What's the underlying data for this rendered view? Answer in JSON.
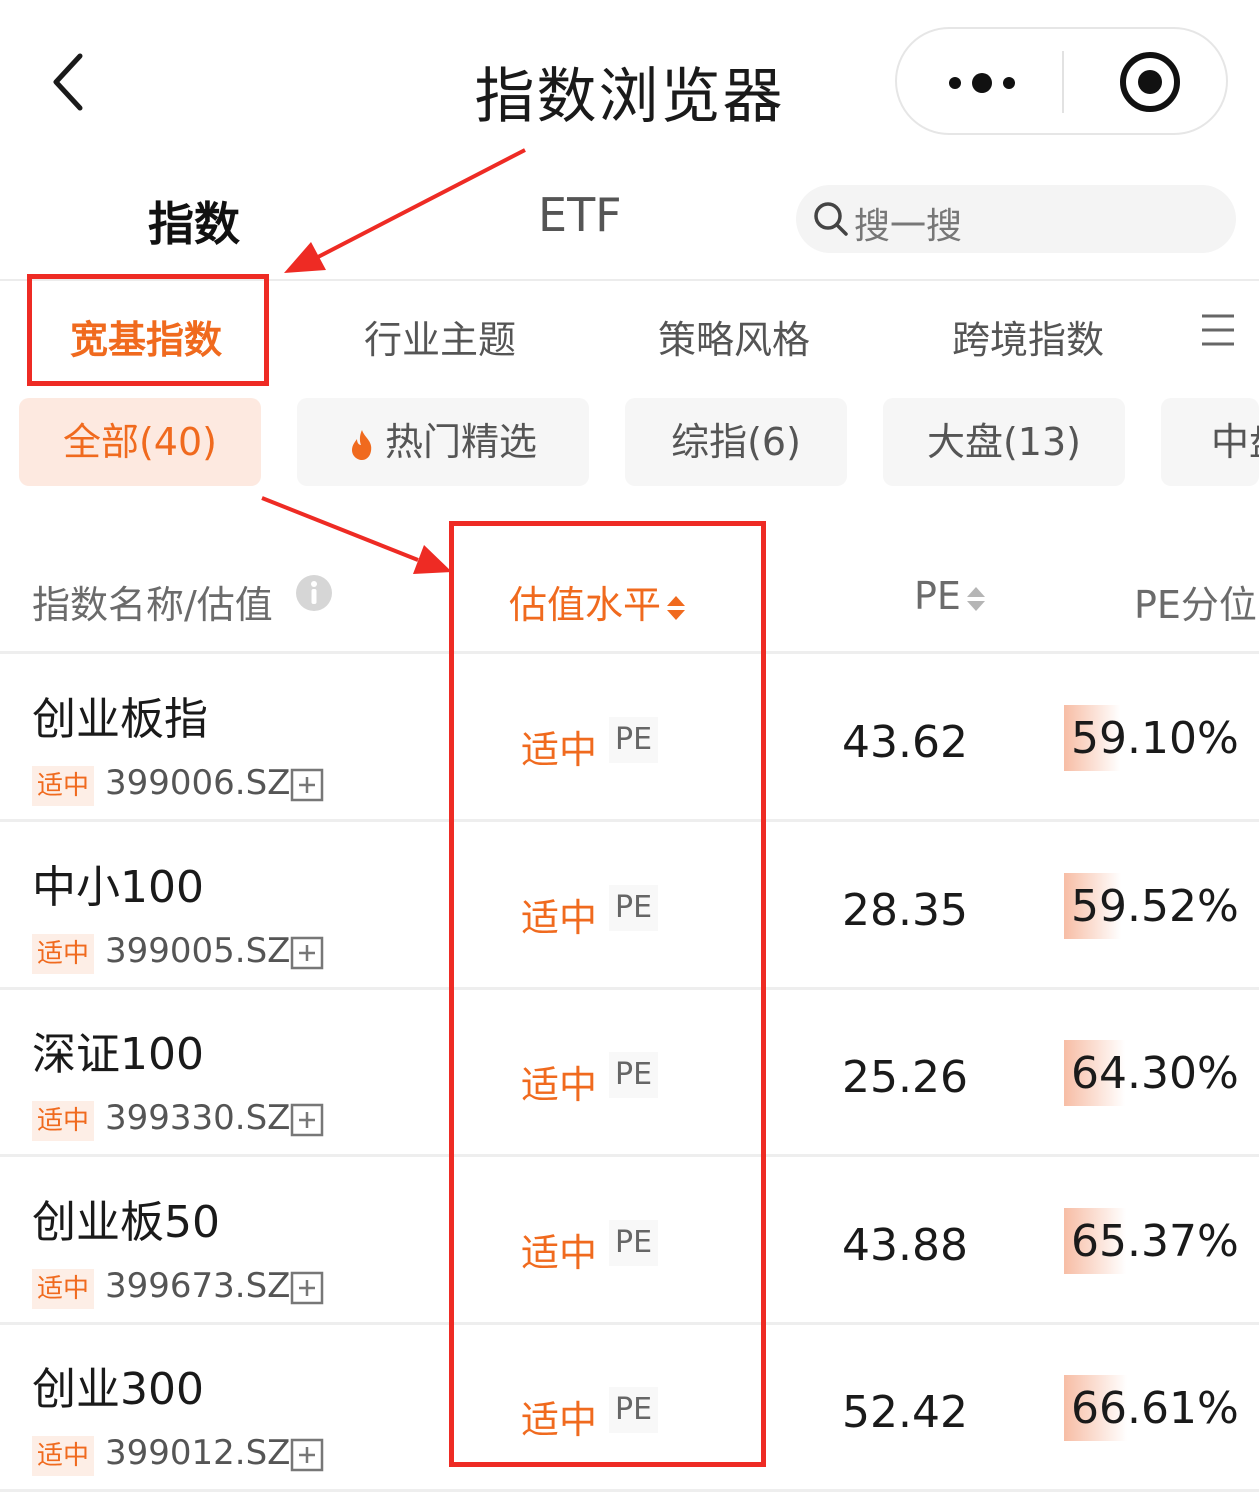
{
  "header": {
    "title": "指数浏览器",
    "icons": [
      "back-icon",
      "more-dots-icon",
      "target-icon"
    ]
  },
  "primary_tabs": [
    {
      "label": "指数",
      "active": true
    },
    {
      "label": "ETF",
      "active": false
    }
  ],
  "search": {
    "placeholder": "搜一搜",
    "icon": "search-icon"
  },
  "category_tabs": [
    {
      "label": "宽基指数",
      "active": true
    },
    {
      "label": "行业主题",
      "active": false
    },
    {
      "label": "策略风格",
      "active": false
    },
    {
      "label": "跨境指数",
      "active": false
    }
  ],
  "chips": [
    {
      "label": "全部(40)",
      "active": true
    },
    {
      "label": "热门精选",
      "icon": "fire-icon"
    },
    {
      "label": "综指(6)"
    },
    {
      "label": "大盘(13)"
    },
    {
      "label": "中盘"
    }
  ],
  "columns": {
    "name": "指数名称/估值",
    "level": "估值水平",
    "pe": "PE",
    "pe_percentile": "PE分位"
  },
  "rows": [
    {
      "name": "创业板指",
      "tag": "适中",
      "code": "399006.SZ",
      "level": "适中",
      "metric": "PE",
      "pe": "43.62",
      "pe_percentile": "59.10%",
      "percentile_value": 59.1
    },
    {
      "name": "中小100",
      "tag": "适中",
      "code": "399005.SZ",
      "level": "适中",
      "metric": "PE",
      "pe": "28.35",
      "pe_percentile": "59.52%",
      "percentile_value": 59.52
    },
    {
      "name": "深证100",
      "tag": "适中",
      "code": "399330.SZ",
      "level": "适中",
      "metric": "PE",
      "pe": "25.26",
      "pe_percentile": "64.30%",
      "percentile_value": 64.3
    },
    {
      "name": "创业板50",
      "tag": "适中",
      "code": "399673.SZ",
      "level": "适中",
      "metric": "PE",
      "pe": "43.88",
      "pe_percentile": "65.37%",
      "percentile_value": 65.37
    },
    {
      "name": "创业300",
      "tag": "适中",
      "code": "399012.SZ",
      "level": "适中",
      "metric": "PE",
      "pe": "52.42",
      "pe_percentile": "66.61%",
      "percentile_value": 66.61
    }
  ],
  "colors": {
    "accent": "#f06a1e",
    "annotation": "#ee2b24",
    "percentile_bar": "#f7bda5"
  }
}
